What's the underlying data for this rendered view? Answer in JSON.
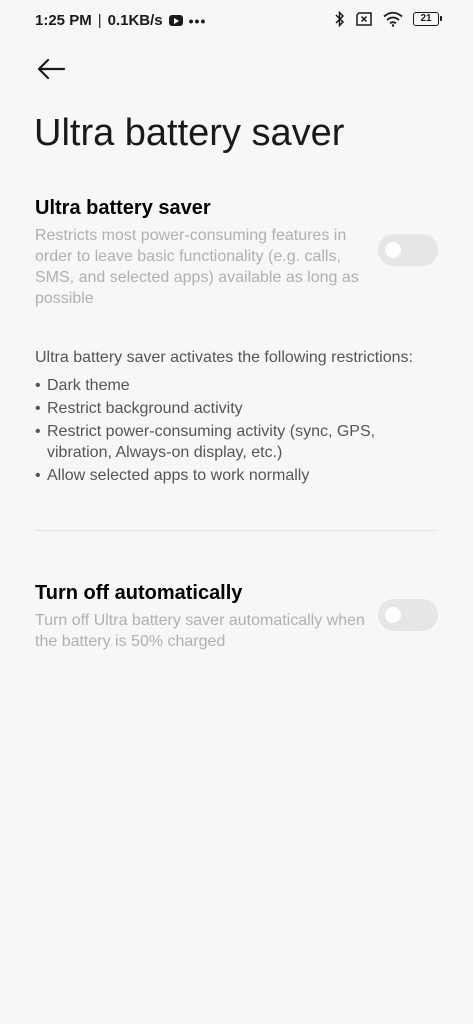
{
  "status_bar": {
    "time": "1:25 PM",
    "separator": "|",
    "speed": "0.1KB/s",
    "more_indicator": "•••",
    "battery_level": "21",
    "icons": [
      "youtube-icon",
      "bluetooth-icon",
      "no-sim-icon",
      "wifi-icon",
      "battery-icon"
    ]
  },
  "header": {
    "back_icon": "back-arrow-icon",
    "title": "Ultra battery saver"
  },
  "ultra_saver": {
    "title": "Ultra battery saver",
    "description": "Restricts most power-consuming features in order to leave basic functionality (e.g. calls, SMS, and selected apps) available as long as possible",
    "enabled": false
  },
  "restrictions": {
    "intro": "Ultra battery saver activates the following restrictions:",
    "items": [
      "Dark theme",
      "Restrict background activity",
      "Restrict power-consuming activity (sync, GPS, vibration, Always-on display, etc.)",
      "Allow selected apps to work normally"
    ]
  },
  "auto_off": {
    "title": "Turn off automatically",
    "description": "Turn off Ultra battery saver automatically when the battery is 50% charged",
    "enabled": false
  },
  "colors": {
    "background": "#f7f7f7",
    "title_text": "#000000",
    "description_text": "#b0b0b0",
    "body_text": "#555555",
    "toggle_off": "#e6e6e6"
  }
}
